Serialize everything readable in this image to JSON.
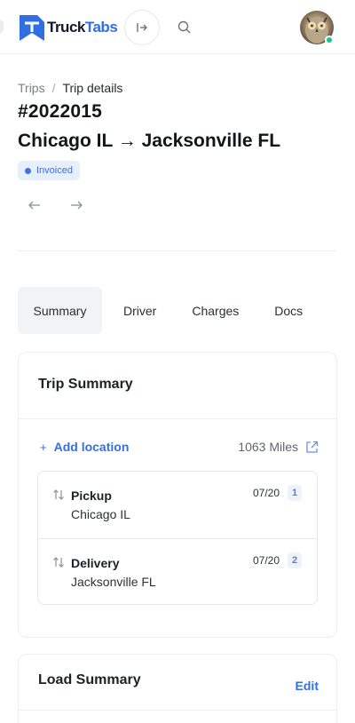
{
  "header": {
    "brand_primary": "Truck",
    "brand_secondary": "Tabs",
    "brand_color": "#2f6fe4",
    "collapse_icon": "sidebar-toggle-icon",
    "search_icon": "search-icon",
    "avatar_status": "online",
    "status_color": "#18c58b"
  },
  "breadcrumb": {
    "parent": "Trips",
    "separator": "/",
    "current": "Trip details"
  },
  "trip": {
    "number": "#2022015",
    "route": "Chicago IL → Jacksonville FL",
    "status": "Invoiced"
  },
  "tabs": [
    {
      "label": "Summary",
      "active": true
    },
    {
      "label": "Driver",
      "active": false
    },
    {
      "label": "Charges",
      "active": false
    },
    {
      "label": "Docs",
      "active": false
    }
  ],
  "trip_summary": {
    "title": "Trip Summary",
    "add_location": "Add location",
    "plus": "+",
    "miles": "1063 Miles",
    "stops": [
      {
        "type": "Pickup",
        "city": "Chicago IL",
        "date": "07/20",
        "index": "1"
      },
      {
        "type": "Delivery",
        "city": "Jacksonville FL",
        "date": "07/20",
        "index": "2"
      }
    ]
  },
  "load_summary": {
    "title": "Load Summary",
    "edit": "Edit"
  }
}
